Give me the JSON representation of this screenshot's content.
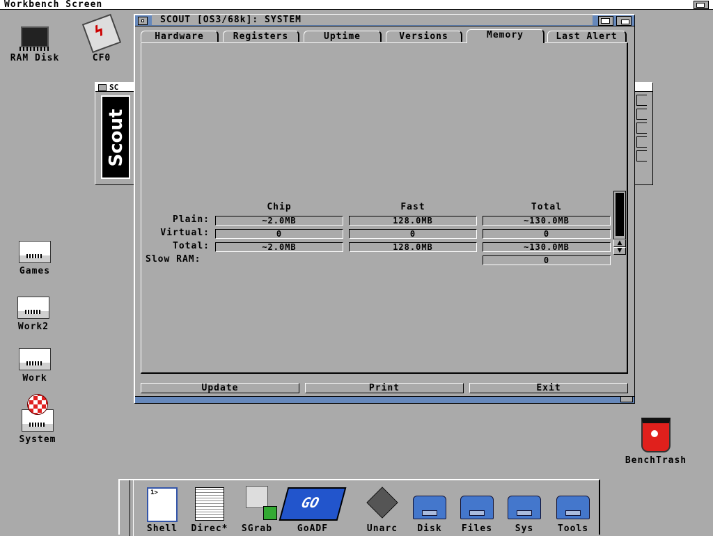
{
  "screen": {
    "title": "Workbench Screen"
  },
  "desktop_icons": {
    "ram_disk": "RAM Disk",
    "cf0": "CF0",
    "games": "Games",
    "work2": "Work2",
    "work": "Work",
    "system": "System",
    "benchtrash": "BenchTrash"
  },
  "bg_window": {
    "title_fragment": "SC",
    "logo_text": "Scout"
  },
  "window": {
    "title": "SCOUT [OS3/68k]: SYSTEM",
    "tabs": [
      {
        "label": "Hardware"
      },
      {
        "label": "Registers"
      },
      {
        "label": "Uptime"
      },
      {
        "label": "Versions"
      },
      {
        "label": "Memory",
        "active": true
      },
      {
        "label": "Last Alert"
      }
    ],
    "memory": {
      "columns": [
        "Chip",
        "Fast",
        "Total"
      ],
      "rows": [
        {
          "label": "Plain:",
          "chip": "~2.0MB",
          "fast": "128.0MB",
          "total": "~130.0MB"
        },
        {
          "label": "Virtual:",
          "chip": "0",
          "fast": "0",
          "total": "0"
        },
        {
          "label": "Total:",
          "chip": "~2.0MB",
          "fast": "128.0MB",
          "total": "~130.0MB"
        },
        {
          "label": "Slow RAM:",
          "total": "0"
        }
      ]
    },
    "buttons": {
      "update": "Update",
      "print": "Print",
      "exit": "Exit"
    }
  },
  "dock": {
    "items": [
      {
        "label": "Shell"
      },
      {
        "label": "Direc*"
      },
      {
        "label": "SGrab"
      },
      {
        "label": "GoADF"
      },
      {
        "label": "Unarc"
      },
      {
        "label": "Disk"
      },
      {
        "label": "Files"
      },
      {
        "label": "Sys"
      },
      {
        "label": "Tools"
      }
    ]
  },
  "colors": {
    "background": "#aaaaaa",
    "titlebar_active": "#6688bb",
    "drawer_blue": "#4477cc"
  }
}
